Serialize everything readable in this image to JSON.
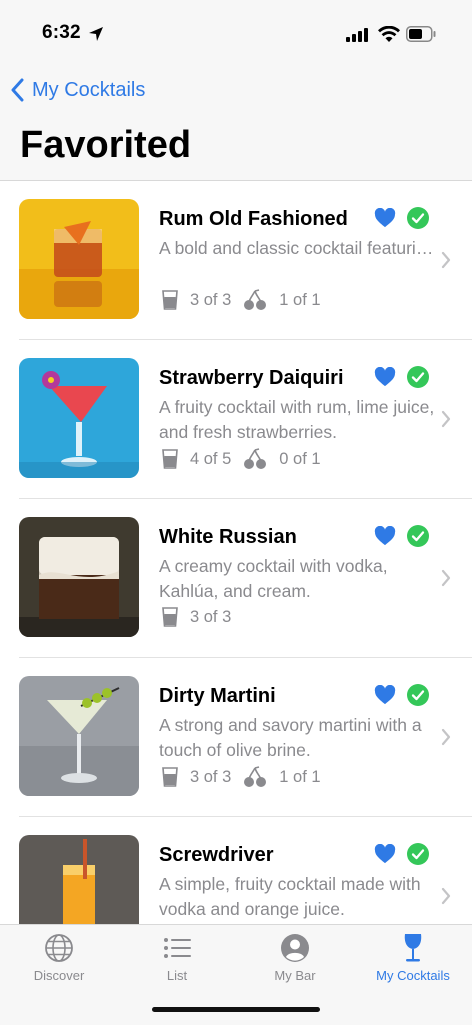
{
  "status_bar": {
    "time": "6:32"
  },
  "nav": {
    "back_label": "My Cocktails",
    "title": "Favorited"
  },
  "items": [
    {
      "name": "Rum Old Fashioned",
      "description": "A bold and classic cocktail featuring dark rum with a touch...",
      "glass_count": "3 of 3",
      "cherry_count": "1 of 1",
      "favorited": true,
      "available": true
    },
    {
      "name": "Strawberry Daiquiri",
      "description": "A fruity cocktail with rum, lime juice, and fresh strawberries.",
      "glass_count": "4 of 5",
      "cherry_count": "0 of 1",
      "favorited": true,
      "available": true
    },
    {
      "name": "White Russian",
      "description": "A creamy cocktail with vodka, Kahlúa, and cream.",
      "glass_count": "3 of 3",
      "favorited": true,
      "available": true
    },
    {
      "name": "Dirty Martini",
      "description": "A strong and savory martini with a touch of olive brine.",
      "glass_count": "3 of 3",
      "cherry_count": "1 of 1",
      "favorited": true,
      "available": true
    },
    {
      "name": "Screwdriver",
      "description": "A simple, fruity cocktail made with vodka and orange juice.",
      "favorited": true,
      "available": true
    }
  ],
  "tabs": [
    {
      "label": "Discover",
      "icon": "globe-icon",
      "active": false
    },
    {
      "label": "List",
      "icon": "list-icon",
      "active": false
    },
    {
      "label": "My Bar",
      "icon": "person-icon",
      "active": false
    },
    {
      "label": "My Cocktails",
      "icon": "wine-glass-icon",
      "active": true
    }
  ],
  "colors": {
    "accent": "#2f7ae5",
    "check_green": "#34c759",
    "secondary_text": "#8a8a8e"
  }
}
